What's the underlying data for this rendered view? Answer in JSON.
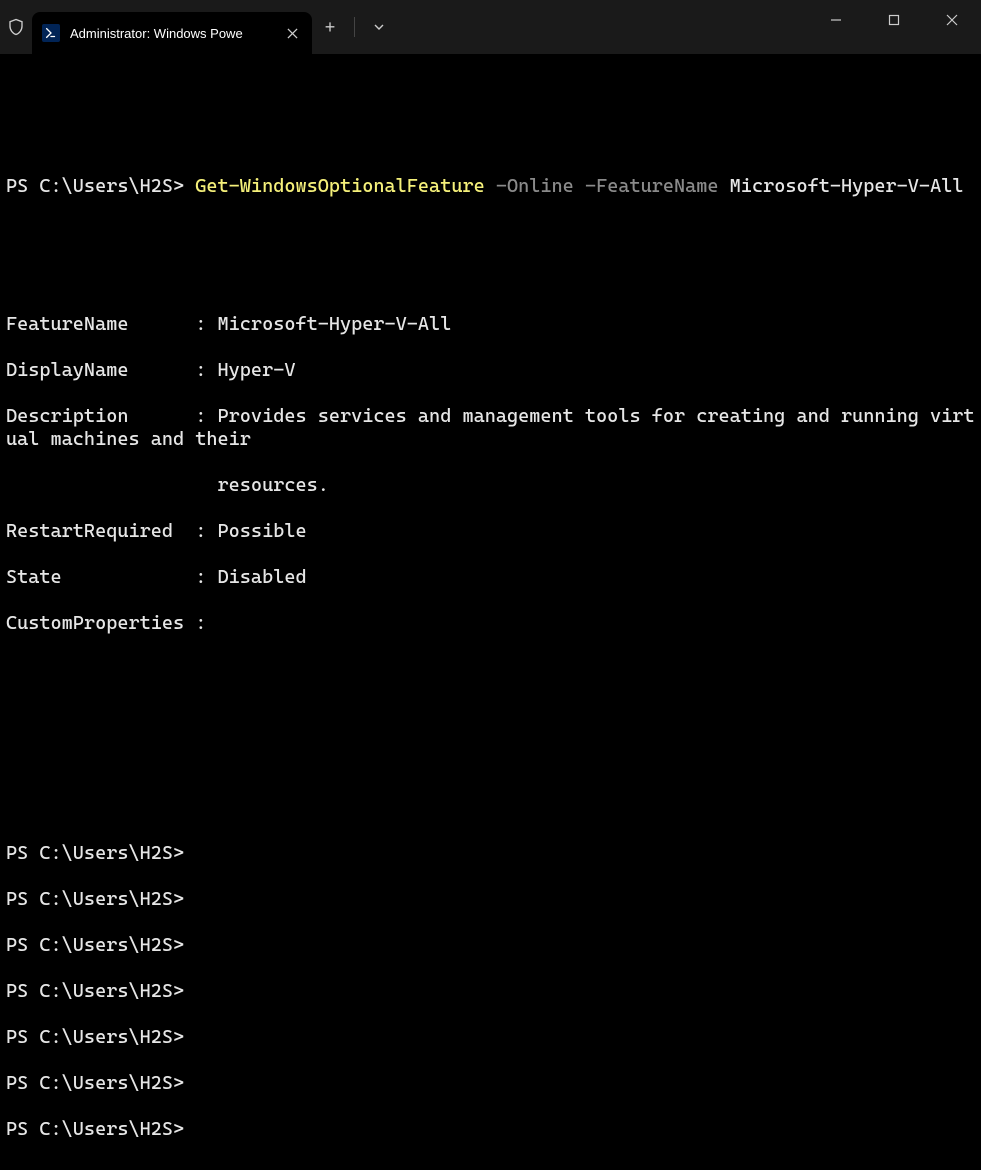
{
  "window": {
    "tab_title": "Administrator: Windows Powe"
  },
  "terminal": {
    "prompt": "PS C:\\Users\\H2S>",
    "command": {
      "cmdlet": "Get-WindowsOptionalFeature",
      "param1": "-Online",
      "param2": "-FeatureName",
      "arg": "Microsoft-Hyper-V-All"
    },
    "output": {
      "FeatureName": "Microsoft-Hyper-V-All",
      "DisplayName": "Hyper-V",
      "Description": "Provides services and management tools for creating and running virtual machines and their",
      "DescriptionCont": "resources.",
      "RestartRequired": "Possible",
      "State": "Disabled",
      "CustomProperties": ""
    },
    "labels": {
      "FeatureName": "FeatureName      : ",
      "DisplayName": "DisplayName      : ",
      "Description": "Description      : ",
      "RestartRequired": "RestartRequired  : ",
      "State": "State            : ",
      "CustomProperties": "CustomProperties :"
    },
    "empty_prompts_count": 7
  }
}
